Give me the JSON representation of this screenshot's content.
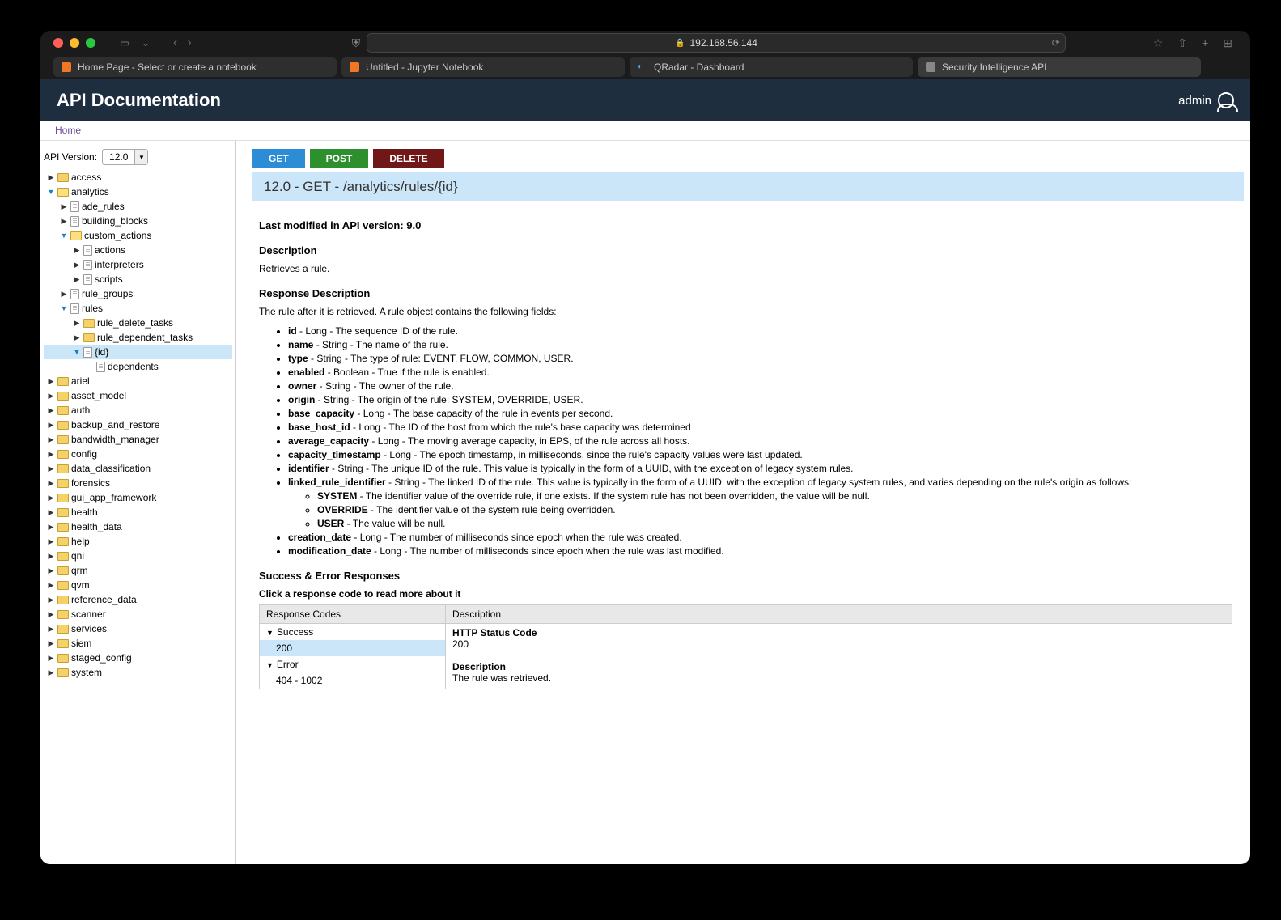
{
  "browser": {
    "url": "192.168.56.144",
    "tabs": [
      {
        "title": "Home Page - Select or create a notebook"
      },
      {
        "title": "Untitled - Jupyter Notebook"
      },
      {
        "title": "QRadar - Dashboard"
      },
      {
        "title": "Security Intelligence API"
      }
    ]
  },
  "app": {
    "title": "API Documentation",
    "user": "admin",
    "breadcrumb": "Home"
  },
  "sidebar": {
    "version_label": "API Version:",
    "version_value": "12.0",
    "tree": [
      {
        "label": "access",
        "type": "folder",
        "indent": 0,
        "open": false
      },
      {
        "label": "analytics",
        "type": "folder",
        "indent": 0,
        "open": true
      },
      {
        "label": "ade_rules",
        "type": "file",
        "indent": 1,
        "open": false,
        "expander": true
      },
      {
        "label": "building_blocks",
        "type": "file",
        "indent": 1,
        "open": false,
        "expander": true
      },
      {
        "label": "custom_actions",
        "type": "folder",
        "indent": 1,
        "open": true
      },
      {
        "label": "actions",
        "type": "file",
        "indent": 2,
        "open": false,
        "expander": true
      },
      {
        "label": "interpreters",
        "type": "file",
        "indent": 2,
        "open": false,
        "expander": true
      },
      {
        "label": "scripts",
        "type": "file",
        "indent": 2,
        "open": false,
        "expander": true
      },
      {
        "label": "rule_groups",
        "type": "file",
        "indent": 1,
        "open": false,
        "expander": true
      },
      {
        "label": "rules",
        "type": "file",
        "indent": 1,
        "open": true,
        "expander": true
      },
      {
        "label": "rule_delete_tasks",
        "type": "folder",
        "indent": 2,
        "open": false,
        "expander": true
      },
      {
        "label": "rule_dependent_tasks",
        "type": "folder",
        "indent": 2,
        "open": false,
        "expander": true
      },
      {
        "label": "{id}",
        "type": "file",
        "indent": 2,
        "open": true,
        "expander": true,
        "selected": true
      },
      {
        "label": "dependents",
        "type": "file",
        "indent": 3,
        "open": false,
        "expander": false
      },
      {
        "label": "ariel",
        "type": "folder",
        "indent": 0,
        "open": false
      },
      {
        "label": "asset_model",
        "type": "folder",
        "indent": 0,
        "open": false
      },
      {
        "label": "auth",
        "type": "folder",
        "indent": 0,
        "open": false
      },
      {
        "label": "backup_and_restore",
        "type": "folder",
        "indent": 0,
        "open": false
      },
      {
        "label": "bandwidth_manager",
        "type": "folder",
        "indent": 0,
        "open": false
      },
      {
        "label": "config",
        "type": "folder",
        "indent": 0,
        "open": false
      },
      {
        "label": "data_classification",
        "type": "folder",
        "indent": 0,
        "open": false
      },
      {
        "label": "forensics",
        "type": "folder",
        "indent": 0,
        "open": false
      },
      {
        "label": "gui_app_framework",
        "type": "folder",
        "indent": 0,
        "open": false
      },
      {
        "label": "health",
        "type": "folder",
        "indent": 0,
        "open": false
      },
      {
        "label": "health_data",
        "type": "folder",
        "indent": 0,
        "open": false
      },
      {
        "label": "help",
        "type": "folder",
        "indent": 0,
        "open": false
      },
      {
        "label": "qni",
        "type": "folder",
        "indent": 0,
        "open": false
      },
      {
        "label": "qrm",
        "type": "folder",
        "indent": 0,
        "open": false
      },
      {
        "label": "qvm",
        "type": "folder",
        "indent": 0,
        "open": false
      },
      {
        "label": "reference_data",
        "type": "folder",
        "indent": 0,
        "open": false
      },
      {
        "label": "scanner",
        "type": "folder",
        "indent": 0,
        "open": false
      },
      {
        "label": "services",
        "type": "folder",
        "indent": 0,
        "open": false
      },
      {
        "label": "siem",
        "type": "folder",
        "indent": 0,
        "open": false
      },
      {
        "label": "staged_config",
        "type": "folder",
        "indent": 0,
        "open": false
      },
      {
        "label": "system",
        "type": "folder",
        "indent": 0,
        "open": false
      }
    ]
  },
  "methods": {
    "get": "GET",
    "post": "POST",
    "delete": "DELETE"
  },
  "doc": {
    "title": "12.0 - GET - /analytics/rules/{id}",
    "last_modified_label": "Last modified in API version: 9.0",
    "description_heading": "Description",
    "description_text": "Retrieves a rule.",
    "response_heading": "Response Description",
    "response_intro": "The rule after it is retrieved. A rule object contains the following fields:",
    "fields": [
      {
        "name": "id",
        "desc": " - Long - The sequence ID of the rule."
      },
      {
        "name": "name",
        "desc": " - String - The name of the rule."
      },
      {
        "name": "type",
        "desc": " - String - The type of rule: EVENT, FLOW, COMMON, USER."
      },
      {
        "name": "enabled",
        "desc": " - Boolean - True if the rule is enabled."
      },
      {
        "name": "owner",
        "desc": " - String - The owner of the rule."
      },
      {
        "name": "origin",
        "desc": " - String - The origin of the rule: SYSTEM, OVERRIDE, USER."
      },
      {
        "name": "base_capacity",
        "desc": " - Long - The base capacity of the rule in events per second."
      },
      {
        "name": "base_host_id",
        "desc": " - Long - The ID of the host from which the rule's base capacity was determined"
      },
      {
        "name": "average_capacity",
        "desc": " - Long - The moving average capacity, in EPS, of the rule across all hosts."
      },
      {
        "name": "capacity_timestamp",
        "desc": " - Long - The epoch timestamp, in milliseconds, since the rule's capacity values were last updated."
      },
      {
        "name": "identifier",
        "desc": " - String - The unique ID of the rule. This value is typically in the form of a UUID, with the exception of legacy system rules."
      },
      {
        "name": "linked_rule_identifier",
        "desc": " - String - The linked ID of the rule. This value is typically in the form of a UUID, with the exception of legacy system rules, and varies depending on the rule's origin as follows:"
      },
      {
        "name": "creation_date",
        "desc": " - Long - The number of milliseconds since epoch when the rule was created."
      },
      {
        "name": "modification_date",
        "desc": " - Long - The number of milliseconds since epoch when the rule was last modified."
      }
    ],
    "sub_fields": [
      {
        "name": "SYSTEM",
        "desc": " - The identifier value of the override rule, if one exists. If the system rule has not been overridden, the value will be null."
      },
      {
        "name": "OVERRIDE",
        "desc": " - The identifier value of the system rule being overridden."
      },
      {
        "name": "USER",
        "desc": " - The value will be null."
      }
    ],
    "success_heading": "Success & Error Responses",
    "click_hint": "Click a response code to read more about it",
    "table": {
      "col1": "Response Codes",
      "col2": "Description",
      "success_label": "Success",
      "success_code": "200",
      "error_label": "Error",
      "error_code": "404 - 1002",
      "status_label": "HTTP Status Code",
      "status_value": "200",
      "desc_label": "Description",
      "desc_value": "The rule was retrieved."
    }
  }
}
